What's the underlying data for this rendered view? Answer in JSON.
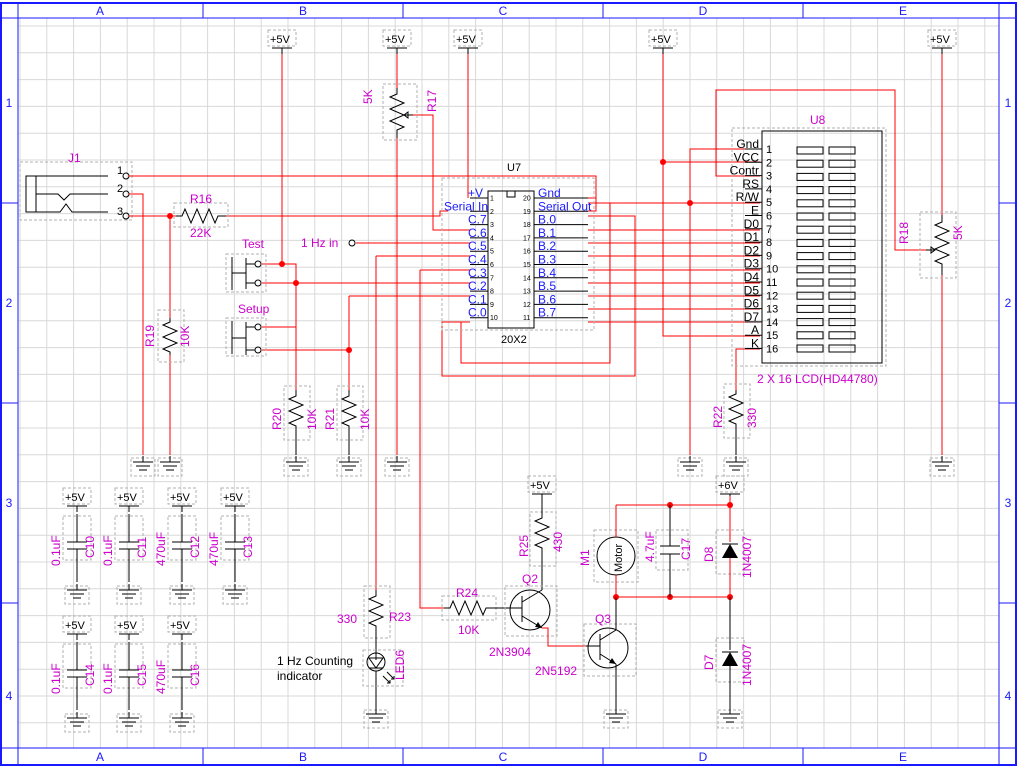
{
  "border": {
    "col_labels": [
      "A",
      "B",
      "C",
      "D",
      "E"
    ],
    "row_labels": [
      "1",
      "2",
      "3",
      "4"
    ]
  },
  "power": {
    "vcc": "+5V",
    "vmotor": "+6V"
  },
  "j1": {
    "ref": "J1",
    "pins": [
      "1",
      "2",
      "3"
    ]
  },
  "r16": {
    "ref": "R16",
    "value": "22K"
  },
  "r17": {
    "ref": "R17",
    "value": "5K"
  },
  "r18": {
    "ref": "R18",
    "value": "5K"
  },
  "r19": {
    "ref": "R19",
    "value": "10K"
  },
  "r20": {
    "ref": "R20",
    "value": "10K"
  },
  "r21": {
    "ref": "R21",
    "value": "10K"
  },
  "r22": {
    "ref": "R22",
    "value": "330"
  },
  "r23": {
    "ref": "R23",
    "value": "330"
  },
  "r24": {
    "ref": "R24",
    "value": "10K"
  },
  "r25": {
    "ref": "R25",
    "value": "430"
  },
  "switches": {
    "test": "Test",
    "setup": "Setup"
  },
  "hz_in": "1 Hz in",
  "u7": {
    "ref": "U7",
    "part": "20X2",
    "left_labels": [
      "+V",
      "Serial In",
      "C.7",
      "C.6",
      "C.5",
      "C.4",
      "C.3",
      "C.2",
      "C.1",
      "C.0"
    ],
    "right_labels": [
      "Gnd",
      "Serial Out",
      "B.0",
      "B.1",
      "B.2",
      "B.3",
      "B.4",
      "B.5",
      "B.6",
      "B.7"
    ],
    "left_pins": [
      "1",
      "2",
      "3",
      "4",
      "5",
      "6",
      "7",
      "8",
      "9",
      "10"
    ],
    "right_pins": [
      "20",
      "19",
      "18",
      "17",
      "16",
      "15",
      "14",
      "13",
      "12",
      "11"
    ]
  },
  "u8": {
    "ref": "U8",
    "part": "2 X 16 LCD(HD44780)",
    "pin_labels": [
      "Gnd",
      "VCC",
      "Contr",
      "RS",
      "R/W",
      "E",
      "D0",
      "D1",
      "D2",
      "D3",
      "D4",
      "D5",
      "D6",
      "D7",
      "A",
      "K"
    ],
    "pin_numbers": [
      "1",
      "2",
      "3",
      "4",
      "5",
      "6",
      "7",
      "8",
      "9",
      "10",
      "11",
      "12",
      "13",
      "14",
      "15",
      "16"
    ]
  },
  "caps_row1": [
    {
      "ref": "C10",
      "value": "0.1uF"
    },
    {
      "ref": "C11",
      "value": "0.1uF"
    },
    {
      "ref": "C12",
      "value": "470uF"
    },
    {
      "ref": "C13",
      "value": "470uF"
    }
  ],
  "caps_row2": [
    {
      "ref": "C14",
      "value": "0.1uF"
    },
    {
      "ref": "C15",
      "value": "0.1uF"
    },
    {
      "ref": "C16",
      "value": "470uF"
    }
  ],
  "led": {
    "ref": "LED6",
    "label_line1": "1 Hz Counting",
    "label_line2": "indicator"
  },
  "q2": {
    "ref": "Q2",
    "part": "2N3904"
  },
  "q3": {
    "ref": "Q3",
    "part": "2N5192"
  },
  "m1": {
    "ref": "M1",
    "label": "Motor"
  },
  "c17": {
    "ref": "C17",
    "value": "4.7uF"
  },
  "d7": {
    "ref": "D7",
    "part": "1N4007"
  },
  "d8": {
    "ref": "D8",
    "part": "1N4007"
  }
}
